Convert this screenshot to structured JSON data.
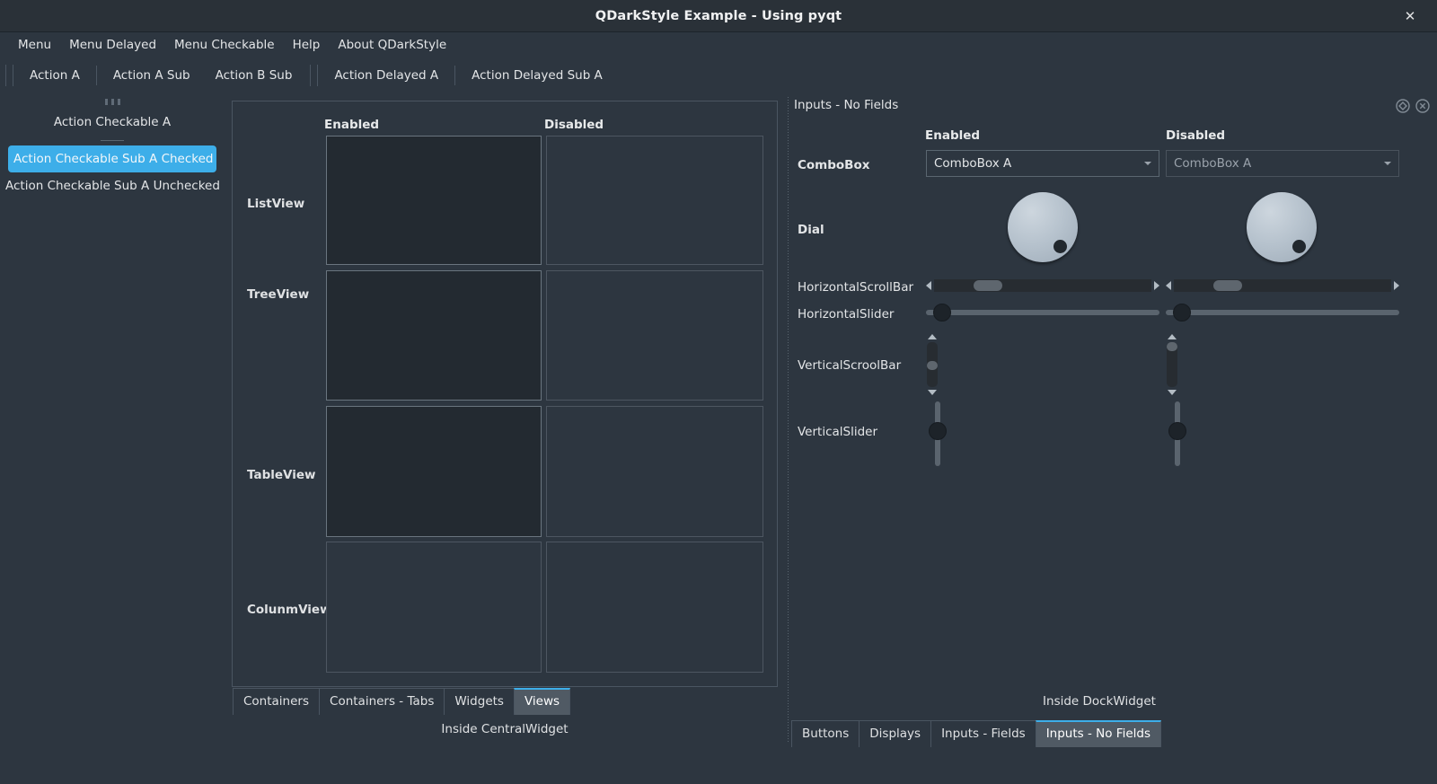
{
  "window": {
    "title": "QDarkStyle Example - Using pyqt",
    "close_label": "✕",
    "accent_color": "#3daee9",
    "background_color": "#2d3640"
  },
  "menubar": {
    "items": [
      {
        "label": "Menu"
      },
      {
        "label": "Menu Delayed"
      },
      {
        "label": "Menu Checkable"
      },
      {
        "label": "Help"
      },
      {
        "label": "About QDarkStyle"
      }
    ]
  },
  "toolbar_top": {
    "group_a": [
      {
        "label": "Action A"
      },
      {
        "label": "Action A Sub"
      },
      {
        "label": "Action B Sub"
      }
    ],
    "group_b": [
      {
        "label": "Action Delayed A"
      },
      {
        "label": "Action Delayed Sub A"
      }
    ]
  },
  "toolbar_left": {
    "items": [
      {
        "label": "Action Checkable A",
        "checked": false
      },
      {
        "label": "Action Checkable Sub A Checked",
        "checked": true
      },
      {
        "label": "Action Checkable Sub A Unchecked",
        "checked": false
      }
    ]
  },
  "central": {
    "caption": "Inside CentralWidget",
    "views": {
      "columns": [
        {
          "label": "Enabled"
        },
        {
          "label": "Disabled"
        }
      ],
      "rows": [
        {
          "label": "ListView"
        },
        {
          "label": "TreeView"
        },
        {
          "label": "TableView"
        },
        {
          "label": "ColunmView"
        }
      ]
    },
    "tabs": [
      {
        "label": "Containers",
        "active": false
      },
      {
        "label": "Containers - Tabs",
        "active": false
      },
      {
        "label": "Widgets",
        "active": false
      },
      {
        "label": "Views",
        "active": true
      }
    ]
  },
  "dock": {
    "title": "Inputs - No Fields",
    "caption": "Inside DockWidget",
    "buttons": [
      {
        "name": "float-icon"
      },
      {
        "name": "close-icon"
      }
    ],
    "columns": [
      {
        "label": "Enabled"
      },
      {
        "label": "Disabled"
      }
    ],
    "rows": [
      {
        "label": "ComboBox"
      },
      {
        "label": "Dial"
      },
      {
        "label": "HorizontalScrollBar"
      },
      {
        "label": "HorizontalSlider"
      },
      {
        "label": "VerticalScroolBar"
      },
      {
        "label": "VerticalSlider"
      }
    ],
    "combobox": {
      "enabled_value": "ComboBox A",
      "disabled_value": "ComboBox A"
    },
    "tabs": [
      {
        "label": "Buttons",
        "active": false
      },
      {
        "label": "Displays",
        "active": false
      },
      {
        "label": "Inputs - Fields",
        "active": false
      },
      {
        "label": "Inputs - No Fields",
        "active": true
      }
    ]
  }
}
